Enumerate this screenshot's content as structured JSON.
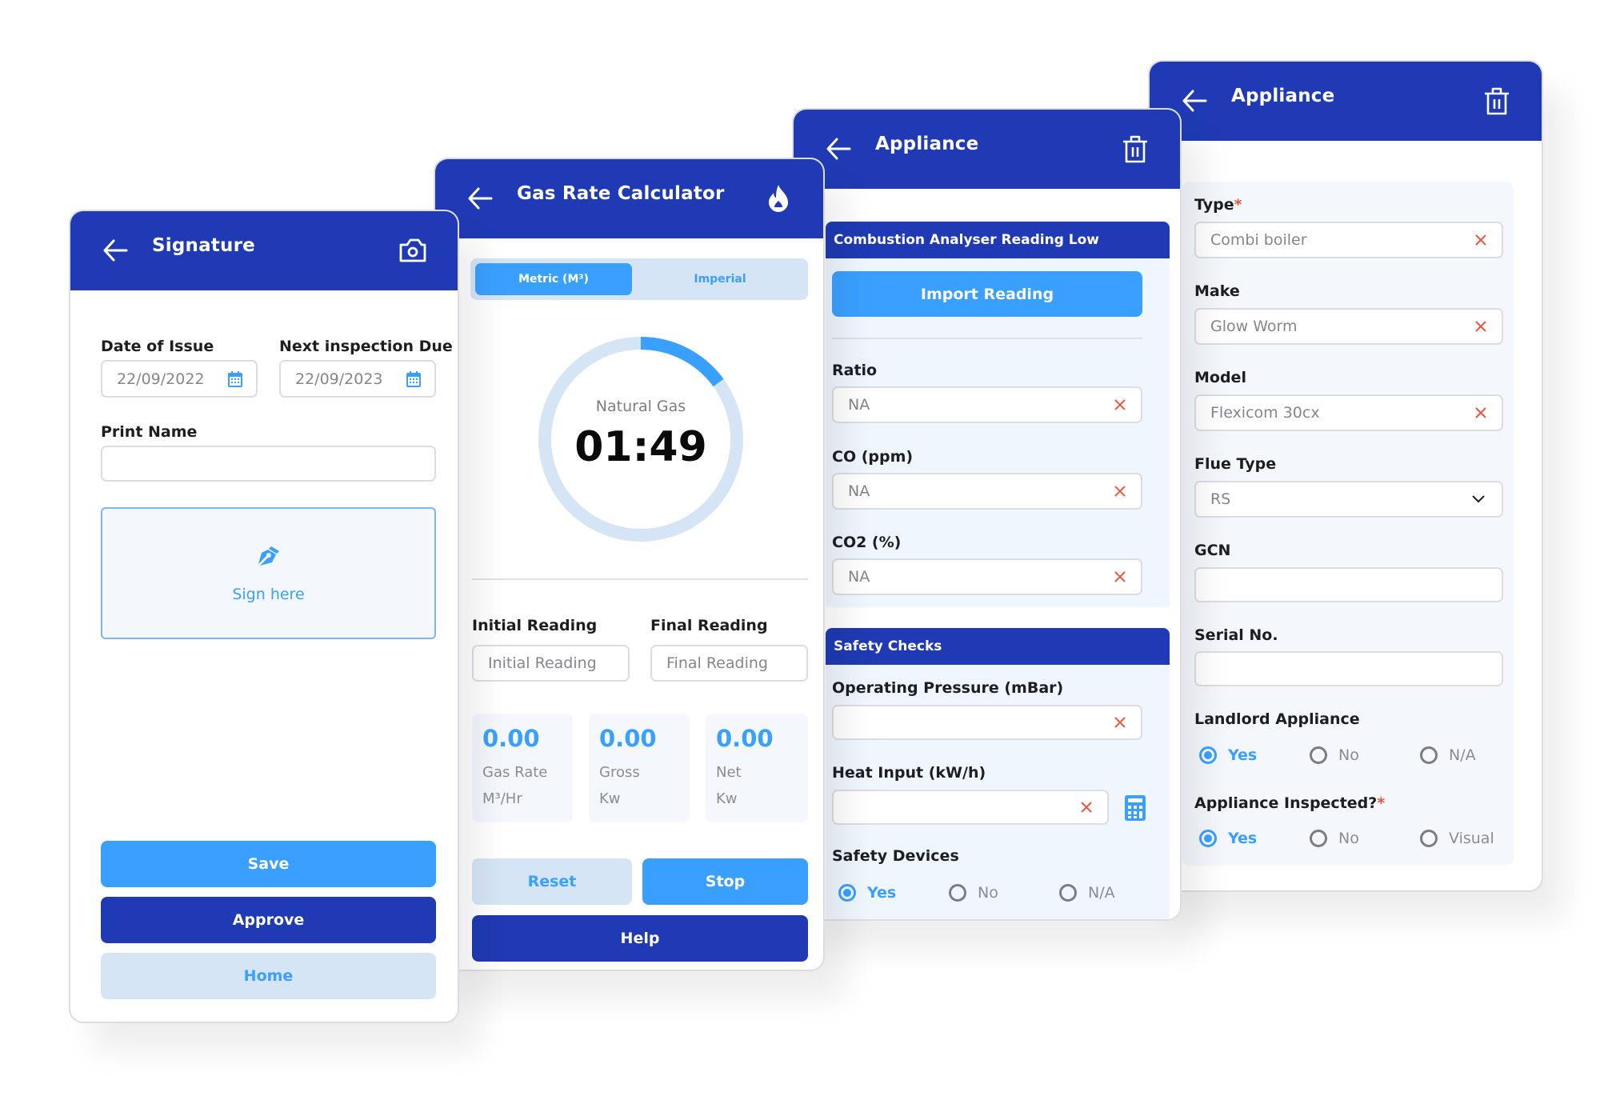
{
  "colors": {
    "header": "#1f3ab4",
    "accent": "#3aa0ff",
    "pale": "#d6e5f6",
    "danger": "#f0553c"
  },
  "signature": {
    "title": "Signature",
    "back_icon": "arrow-left-icon",
    "action_icon": "camera-icon",
    "date_of_issue": {
      "label": "Date of Issue",
      "value": "22/09/2022",
      "icon": "calendar-icon"
    },
    "next_inspection": {
      "label": "Next inspection Due",
      "value": "22/09/2023",
      "icon": "calendar-icon"
    },
    "print_name": {
      "label": "Print Name",
      "value": ""
    },
    "sign_box": {
      "icon": "pen-nib-icon",
      "text": "Sign here"
    },
    "buttons": {
      "save": "Save",
      "approve": "Approve",
      "home": "Home"
    }
  },
  "gas_rate": {
    "title": "Gas Rate Calculator",
    "back_icon": "arrow-left-icon",
    "action_icon": "flame-icon",
    "units_toggle": {
      "options": [
        "Metric (M³)",
        "Imperial"
      ],
      "selected": "Metric (M³)"
    },
    "timer": {
      "gas_type": "Natural Gas",
      "time": "01:49",
      "progress": 0.15
    },
    "initial_reading": {
      "label": "Initial Reading",
      "placeholder": "Initial Reading"
    },
    "final_reading": {
      "label": "Final Reading",
      "placeholder": "Final Reading"
    },
    "stats": [
      {
        "value": "0.00",
        "label": "Gas Rate",
        "unit": "M³/Hr"
      },
      {
        "value": "0.00",
        "label": "Gross",
        "unit": "Kw"
      },
      {
        "value": "0.00",
        "label": "Net",
        "unit": "Kw"
      }
    ],
    "buttons": {
      "reset": "Reset",
      "stop": "Stop",
      "help": "Help"
    }
  },
  "appliance_readings": {
    "title": "Appliance",
    "back_icon": "arrow-left-icon",
    "action_icon": "trash-icon",
    "combustion_section": "Combustion Analyser Reading Low",
    "import_button": "Import Reading",
    "fields": [
      {
        "label": "Ratio",
        "value": "NA"
      },
      {
        "label": "CO (ppm)",
        "value": "NA"
      },
      {
        "label": "CO2 (%)",
        "value": "NA"
      }
    ],
    "safety_section": "Safety Checks",
    "operating_pressure": {
      "label": "Operating Pressure (mBar)",
      "value": ""
    },
    "heat_input": {
      "label": "Heat Input (kW/h)",
      "value": "",
      "calc_icon": "calculator-icon"
    },
    "safety_devices": {
      "label": "Safety Devices",
      "options": [
        "Yes",
        "No",
        "N/A"
      ],
      "selected": "Yes"
    }
  },
  "appliance_details": {
    "title": "Appliance",
    "back_icon": "arrow-left-icon",
    "action_icon": "trash-icon",
    "type": {
      "label": "Type",
      "required": "*",
      "value": "Combi boiler"
    },
    "make": {
      "label": "Make",
      "value": "Glow Worm"
    },
    "model": {
      "label": "Model",
      "value": "Flexicom 30cx"
    },
    "flue_type": {
      "label": "Flue Type",
      "value": "RS"
    },
    "gcn": {
      "label": "GCN",
      "value": ""
    },
    "serial_no": {
      "label": "Serial No.",
      "value": ""
    },
    "landlord_appliance": {
      "label": "Landlord Appliance",
      "options": [
        "Yes",
        "No",
        "N/A"
      ],
      "selected": "Yes"
    },
    "appliance_inspected": {
      "label": "Appliance Inspected?",
      "required": "*",
      "options": [
        "Yes",
        "No",
        "Visual"
      ],
      "selected": "Yes"
    }
  }
}
